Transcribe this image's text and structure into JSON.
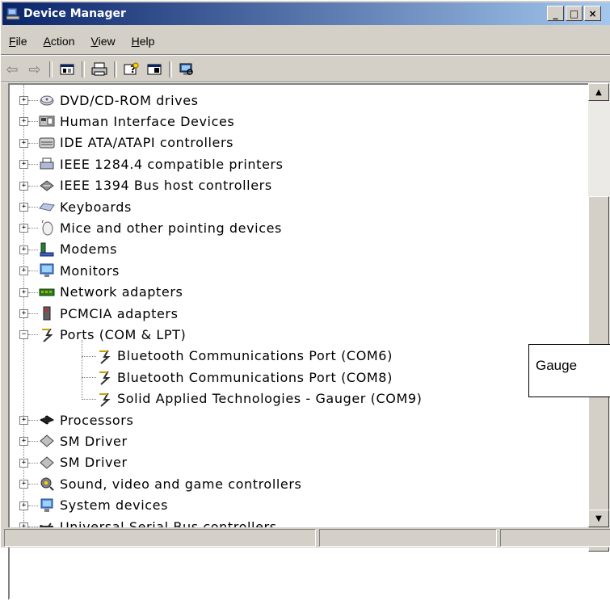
{
  "window": {
    "title": "Device Manager",
    "buttons": [
      "_",
      "□",
      "×"
    ]
  },
  "menu": [
    {
      "key": "F",
      "rest": "ile"
    },
    {
      "key": "A",
      "rest": "ction"
    },
    {
      "key": "V",
      "rest": "iew"
    },
    {
      "key": "H",
      "rest": "elp"
    }
  ],
  "toolbar": {
    "icons": [
      "back-arrow-icon",
      "forward-arrow-icon",
      "properties-icon",
      "print-icon",
      "help-icon",
      "view-icon",
      "scan-hardware-icon"
    ]
  },
  "tree": {
    "items": [
      {
        "label": "DVD/CD-ROM drives",
        "icon": "dvd-icon",
        "expander": "+"
      },
      {
        "label": "Human Interface Devices",
        "icon": "hid-icon",
        "expander": "+"
      },
      {
        "label": "IDE ATA/ATAPI controllers",
        "icon": "ide-icon",
        "expander": "+"
      },
      {
        "label": "IEEE 1284.4 compatible printers",
        "icon": "printer-icon",
        "expander": "+"
      },
      {
        "label": "IEEE 1394 Bus host controllers",
        "icon": "1394-icon",
        "expander": "+"
      },
      {
        "label": "Keyboards",
        "icon": "keyboard-icon",
        "expander": "+"
      },
      {
        "label": "Mice and other pointing devices",
        "icon": "mouse-icon",
        "expander": "+"
      },
      {
        "label": "Modems",
        "icon": "modem-icon",
        "expander": "+"
      },
      {
        "label": "Monitors",
        "icon": "monitor-icon",
        "expander": "+"
      },
      {
        "label": "Network adapters",
        "icon": "network-icon",
        "expander": "+"
      },
      {
        "label": "PCMCIA adapters",
        "icon": "pcmcia-icon",
        "expander": "+"
      },
      {
        "label": "Ports (COM & LPT)",
        "icon": "port-icon",
        "expander": "−"
      }
    ],
    "children": [
      {
        "label": "Bluetooth Communications Port (COM6)",
        "icon": "port-icon"
      },
      {
        "label": "Bluetooth Communications Port (COM8)",
        "icon": "port-icon"
      },
      {
        "label": "Solid Applied Technologies - Gauger (COM9)",
        "icon": "port-icon"
      }
    ],
    "after": [
      {
        "label": "Processors",
        "icon": "processor-icon",
        "expander": "+"
      },
      {
        "label": "SM Driver",
        "icon": "smdriver-icon",
        "expander": "+"
      },
      {
        "label": "SM Driver",
        "icon": "smdriver-icon",
        "expander": "+"
      },
      {
        "label": "Sound, video and game controllers",
        "icon": "sound-icon",
        "expander": "+"
      },
      {
        "label": "System devices",
        "icon": "system-icon",
        "expander": "+"
      },
      {
        "label": "Universal Serial Bus controllers",
        "icon": "usb-icon",
        "expander": "+"
      }
    ]
  },
  "callout": {
    "text": "Gauge"
  },
  "colors": {
    "titlebar_start": "#0a246a",
    "titlebar_end": "#a6caf0",
    "chrome": "#d4d0c8"
  }
}
